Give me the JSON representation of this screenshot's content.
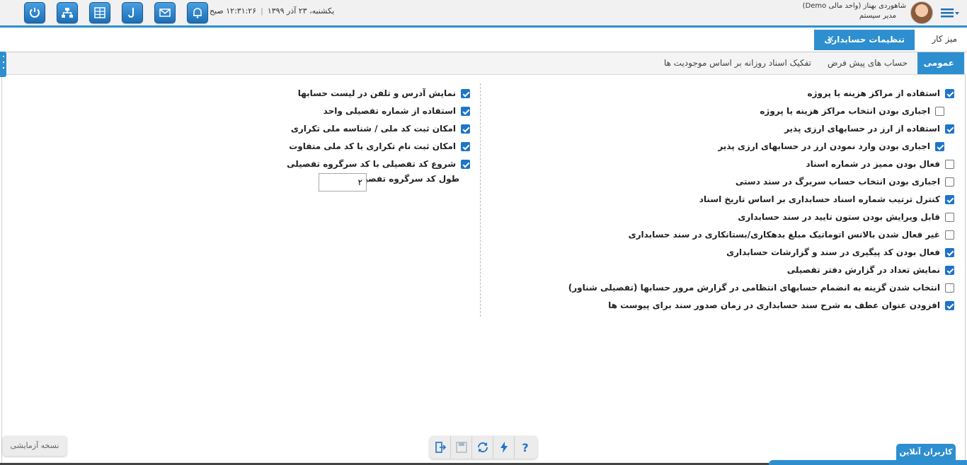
{
  "header": {
    "user_name": "شاهوردی بهناز (واحد مالی Demo)",
    "user_role": "مدیر سیستم",
    "date": "یکشنبه، ۲۳ آذر ۱۳۹۹",
    "time": "۱۲:۳۱:۲۶ صبح",
    "accent_color": "#2d8fd0",
    "toolbar_icons": [
      "power-icon",
      "org-chart-icon",
      "dashboard-icon",
      "hook-icon",
      "mail-icon",
      "bell-icon"
    ]
  },
  "tabs": {
    "desk": "میز کار",
    "active": "تنظیمات حسابداری",
    "close": "×"
  },
  "subtabs": {
    "general": "عمومی",
    "default_accounts": "حساب های پیش فرض",
    "daily_split": "تفکیک اسناد روزانه بر اساس موجودیت ها"
  },
  "right_options": [
    {
      "label": "استفاده از مراکز هزینه یا پروژه",
      "checked": true
    },
    {
      "label": "اجباری بودن انتخاب مراکز هزینه یا پروژه",
      "checked": false
    },
    {
      "label": "استفاده از ارز در حسابهای ارزی پذیر",
      "checked": true
    },
    {
      "label": "اجباری بودن وارد نمودن ارز در حسابهای ارزی پذیر",
      "checked": true
    },
    {
      "label": "فعال بودن ممیز در شماره اسناد",
      "checked": false
    },
    {
      "label": "اجباری بودن انتخاب حساب سربرگ در سند دستی",
      "checked": false
    },
    {
      "label": "کنترل ترتیب شماره اسناد حسابداری بر اساس تاریخ اسناد",
      "checked": true
    },
    {
      "label": "قابل ویرایش بودن ستون تایید در سند حسابداری",
      "checked": false
    },
    {
      "label": "غیر فعال شدن بالانس اتوماتیک مبلغ بدهکاری/بستانکاری در سند حسابداری",
      "checked": false
    },
    {
      "label": "فعال بودن کد پیگیری در سند و گزارشات حسابداری",
      "checked": true
    },
    {
      "label": "نمایش تعداد در گزارش دفتر تفصیلی",
      "checked": true
    },
    {
      "label": "انتخاب شدن گزینه به انضمام حسابهای انتظامی در گزارش مرور حسابها (تفصیلی شناور)",
      "checked": false
    },
    {
      "label": "افزودن عنوان عطف به شرح سند حسابداری در زمان صدور سند برای پیوست ها",
      "checked": true
    }
  ],
  "left_options": [
    {
      "label": "نمایش آدرس و تلفن در لیست حسابها",
      "checked": true
    },
    {
      "label": "استفاده از شماره تفصیلی واحد",
      "checked": true
    },
    {
      "label": "امکان ثبت کد ملی / شناسه ملی تکراری",
      "checked": true
    },
    {
      "label": "امکان ثبت نام تکراری با کد ملی متفاوت",
      "checked": true
    },
    {
      "label": "شروع کد تفصیلی با کد سرگروه تفصیلی",
      "checked": true
    }
  ],
  "detail_group_length": {
    "label": "طول کد سرگروه تفصیلی",
    "value": "۲"
  },
  "footer": {
    "demo_label": "نسخه آزمایشی",
    "online_users": "کاربران آنلاین",
    "tools": [
      "exit-icon",
      "save-icon",
      "refresh-icon",
      "lightning-icon",
      "help-icon"
    ],
    "help_glyph": "?"
  }
}
